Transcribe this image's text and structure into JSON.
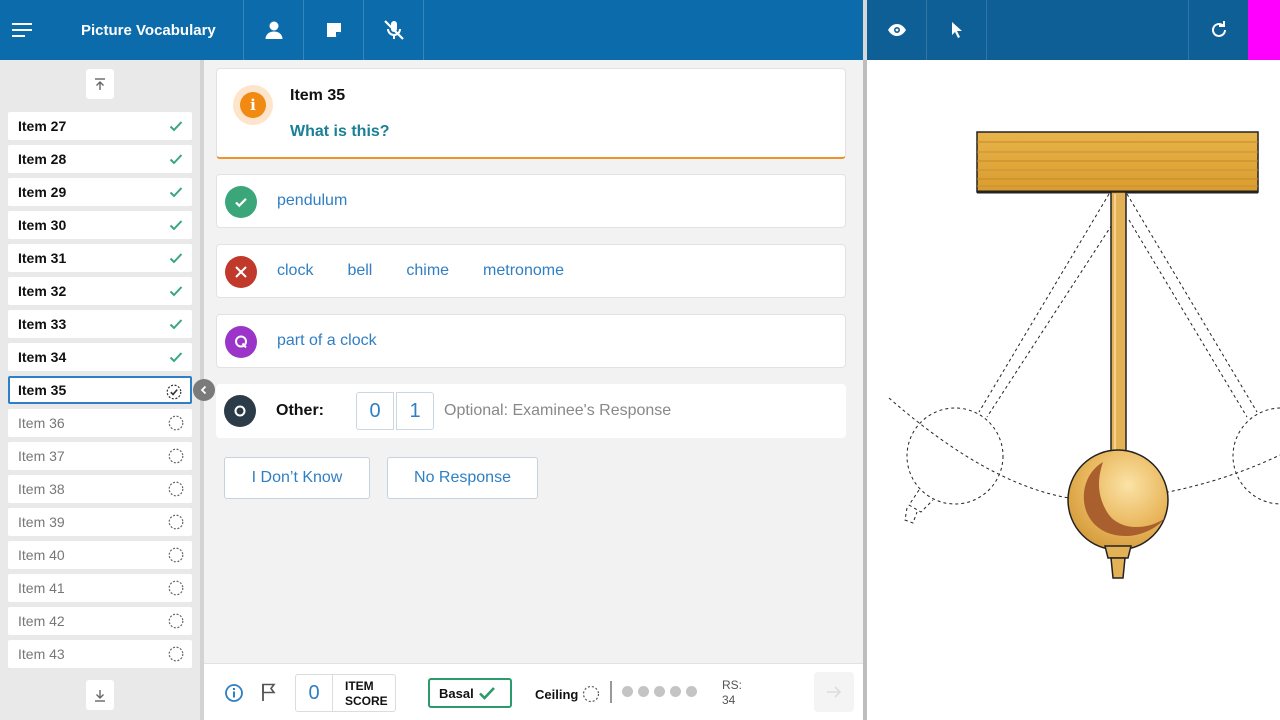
{
  "header": {
    "title": "Picture Vocabulary",
    "menu_icon": "hamburger-menu-icon",
    "icons": [
      "user-icon",
      "note-icon",
      "mic-off-icon"
    ],
    "right_icons": [
      "eye-icon",
      "pointer-icon",
      "refresh-icon"
    ],
    "colors": {
      "left": "#0b6bab",
      "right": "#0e5f95",
      "marker": "#ff00ff"
    }
  },
  "sidebar": {
    "items": [
      {
        "label": "Item 27",
        "status": "done"
      },
      {
        "label": "Item 28",
        "status": "done"
      },
      {
        "label": "Item 29",
        "status": "done"
      },
      {
        "label": "Item 30",
        "status": "done"
      },
      {
        "label": "Item 31",
        "status": "done"
      },
      {
        "label": "Item 32",
        "status": "done"
      },
      {
        "label": "Item 33",
        "status": "done"
      },
      {
        "label": "Item 34",
        "status": "done"
      },
      {
        "label": "Item 35",
        "status": "current"
      },
      {
        "label": "Item 36",
        "status": "pending"
      },
      {
        "label": "Item 37",
        "status": "pending"
      },
      {
        "label": "Item 38",
        "status": "pending"
      },
      {
        "label": "Item 39",
        "status": "pending"
      },
      {
        "label": "Item 40",
        "status": "pending"
      },
      {
        "label": "Item 41",
        "status": "pending"
      },
      {
        "label": "Item 42",
        "status": "pending"
      },
      {
        "label": "Item 43",
        "status": "pending"
      }
    ]
  },
  "question": {
    "item_label": "Item 35",
    "prompt": "What is this?"
  },
  "responses": {
    "correct": [
      "pendulum"
    ],
    "incorrect": [
      "clock",
      "bell",
      "chime",
      "metronome"
    ],
    "query": [
      "part of a clock"
    ],
    "other": {
      "label": "Other:",
      "score_0": "0",
      "score_1": "1",
      "placeholder": "Optional: Examinee's Response"
    }
  },
  "buttons": {
    "dont_know": "I Don’t Know",
    "no_response": "No Response"
  },
  "footer": {
    "item_score": "0",
    "item_score_label_1": "ITEM",
    "item_score_label_2": "SCORE",
    "basal": "Basal",
    "ceiling": "Ceiling",
    "rs_label": "RS:",
    "rs_value": "34",
    "ceiling_dots": 5
  }
}
